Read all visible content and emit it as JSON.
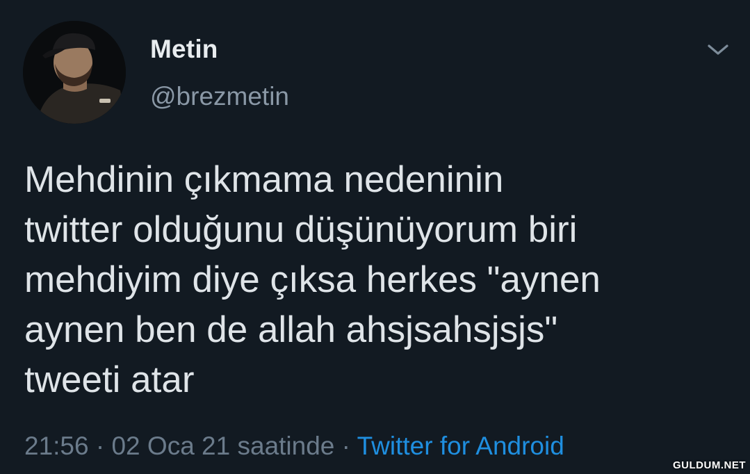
{
  "tweet": {
    "author": {
      "display_name": "Metin",
      "handle": "@brezmetin",
      "avatar_icon": "user-photo-avatar"
    },
    "menu_icon": "chevron-down-icon",
    "text": "Mehdinin çıkmama nedeninin\ntwitter olduğunu düşünüyorum biri\nmehdiyim diye çıksa herkes \"aynen\naynen ben de allah ahsjsahsjsjs\"\ntweeti atar",
    "time": "21:56",
    "separator": "·",
    "date": "02 Oca 21 saatinde",
    "source": "Twitter for Android"
  },
  "watermark": "GULDUM.NET",
  "colors": {
    "background": "#121a22",
    "text": "#dfe4e8",
    "muted": "#6b7b8b",
    "link": "#1f8fe0"
  }
}
